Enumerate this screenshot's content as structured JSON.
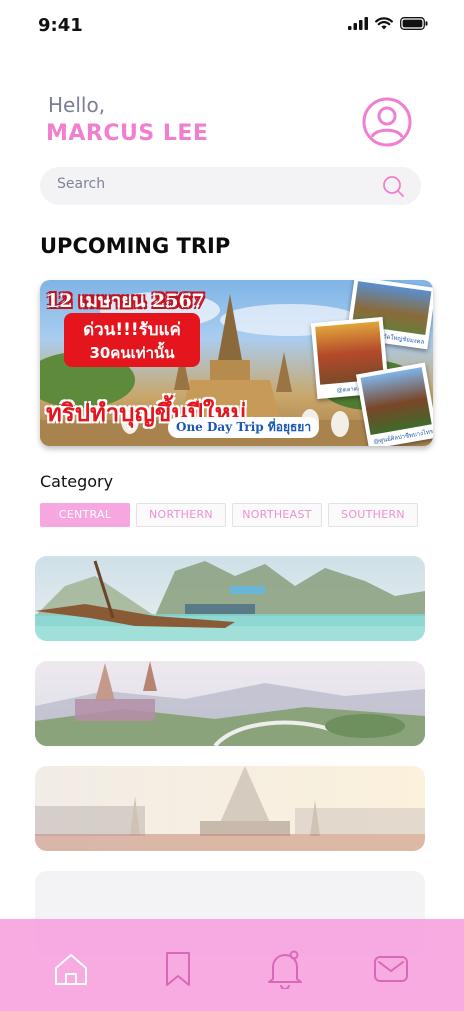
{
  "status_bar": {
    "time": "9:41",
    "icons": [
      "signal-icon",
      "wifi-icon",
      "battery-icon"
    ]
  },
  "header": {
    "greeting": "Hello,",
    "user_name": "MARCUS LEE",
    "avatar_icon": "user-circle-icon"
  },
  "search": {
    "placeholder": "Search",
    "icon": "search-icon"
  },
  "upcoming": {
    "title": "UPCOMING TRIP",
    "banner": {
      "date": "12 เมษายน 2567",
      "hurry_line1": "ด่วน!!!รับแค่",
      "hurry_line2": "30คนเท่านั้น",
      "headline": "ทริปทำบุญขึ้นปีใหม่",
      "subtitle": "One Day Trip ที่อยุธยา",
      "photo_captions": [
        "@วัดใหญ่ชัยมงคล",
        "@ตลาดเก่าวัดใหม่",
        "@ศูนย์ศิลปาชีพบางไทร"
      ]
    }
  },
  "category": {
    "title": "Category",
    "chips": [
      {
        "label": "CENTRAL",
        "active": true
      },
      {
        "label": "NORTHERN",
        "active": false
      },
      {
        "label": "NORTHEAST",
        "active": false
      },
      {
        "label": "SOUTHERN",
        "active": false
      }
    ]
  },
  "nav": {
    "items": [
      "home-icon",
      "bookmark-icon",
      "notification-bell-icon",
      "mail-icon"
    ],
    "active": "home-icon"
  },
  "colors": {
    "accent_pink": "#f07fcf",
    "chip_active": "#f7a7e0",
    "nav_bg": "#f7a4de",
    "muted_text": "#7a7f98"
  }
}
